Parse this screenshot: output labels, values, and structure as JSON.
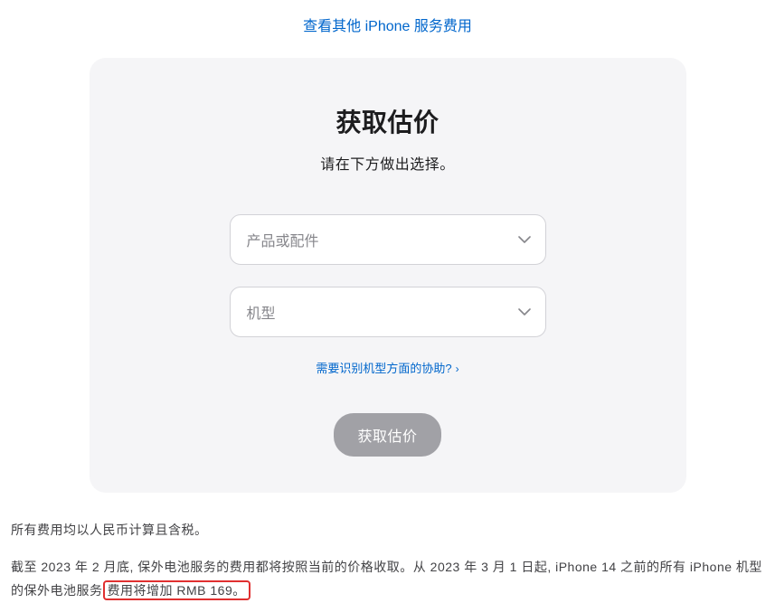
{
  "topLink": {
    "label": "查看其他 iPhone 服务费用"
  },
  "card": {
    "title": "获取估价",
    "subtitle": "请在下方做出选择。",
    "select1": {
      "placeholder": "产品或配件"
    },
    "select2": {
      "placeholder": "机型"
    },
    "helpLink": {
      "label": "需要识别机型方面的协助?",
      "arrow": "›"
    },
    "submit": {
      "label": "获取估价"
    }
  },
  "footer": {
    "line1": "所有费用均以人民币计算且含税。",
    "line2_pre": "截至 2023 年 2 月底, 保外电池服务的费用都将按照当前的价格收取。从 2023 年 3 月 1 日起, iPhone 14 之前的所有 iPhone 机型的保外电池服务",
    "line2_hl": "费用将增加 RMB 169。"
  }
}
